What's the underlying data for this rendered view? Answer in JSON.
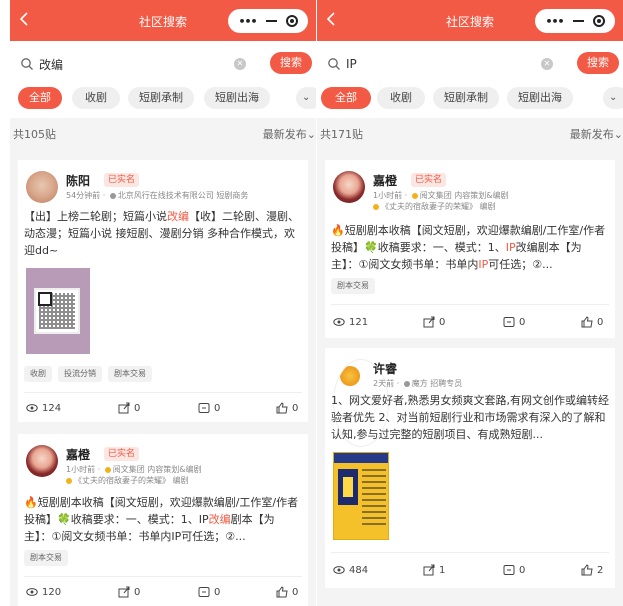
{
  "colors": {
    "accent": "#f35a45",
    "badge_bg": "#fbe6e2",
    "tag_bg": "#f2f2f2"
  },
  "left": {
    "title": "社区搜索",
    "search": {
      "query": "改编",
      "button": "搜索"
    },
    "tabs": [
      "全部",
      "收剧",
      "短剧承制",
      "短剧出海"
    ],
    "count": "共105贴",
    "sort": "最新发布",
    "posts": [
      {
        "user": "陈阳",
        "badge": "已实名",
        "meta": "54分钟前 · ",
        "company": "北京风行在线技术有限公司 短剧商务",
        "text_before": "【出】上榜二轮剧；短篇小说",
        "text_hl": "改编",
        "text_after": "【收】二轮剧、漫剧、动态漫；短篇小说 接短剧、漫剧分销 多种合作模式，欢迎dd~",
        "tags": [
          "收剧",
          "投流分销",
          "剧本交易"
        ],
        "views": "124",
        "shares": "0",
        "comments": "0",
        "likes": "0"
      },
      {
        "user": "嘉橙",
        "badge": "已实名",
        "meta": "1小时前 · ",
        "company": "阅文集团 内容策划&编剧",
        "work": "《丈夫的宿敌妻子的荣耀》 编剧",
        "text_before": "🔥短剧剧本收稿【阅文短剧，欢迎爆款编剧/工作室/作者投稿】🍀收稿要求：一、模式：1、IP",
        "text_hl": "改编",
        "text_after": "剧本【为主】：①阅文女频书单：书单内IP可任选；②...",
        "tags": [
          "剧本交易"
        ],
        "views": "120",
        "shares": "0",
        "comments": "0",
        "likes": "0"
      }
    ]
  },
  "right": {
    "title": "社区搜索",
    "search": {
      "query": "IP",
      "button": "搜索"
    },
    "tabs": [
      "全部",
      "收剧",
      "短剧承制",
      "短剧出海"
    ],
    "count": "共171贴",
    "sort": "最新发布",
    "posts": [
      {
        "user": "嘉橙",
        "badge": "已实名",
        "meta": "1小时前 · ",
        "company": "阅文集团 内容策划&编剧",
        "work": "《丈夫的宿敌妻子的荣耀》 编剧",
        "text_a": "🔥短剧剧本收稿【阅文短剧，欢迎爆款编剧/工作室/作者投稿】🍀收稿要求：一、模式：1、",
        "text_hl1": "IP",
        "text_b": "改编剧本【为主】：①阅文女频书单：书单内",
        "text_hl2": "IP",
        "text_c": "可任选；②...",
        "tags": [
          "剧本交易"
        ],
        "views": "121",
        "shares": "0",
        "comments": "0",
        "likes": "0"
      },
      {
        "user": "许睿",
        "meta": "2天前 · ",
        "company": "魔方 招聘专员",
        "text": "1、网文爱好者,熟悉男女频爽文套路,有网文创作或编转经验者优先 2、对当前短剧行业和市场需求有深入的了解和认知,参与过完整的短剧项目、有成熟短剧...",
        "views": "484",
        "shares": "1",
        "comments": "0",
        "likes": "2"
      }
    ]
  }
}
